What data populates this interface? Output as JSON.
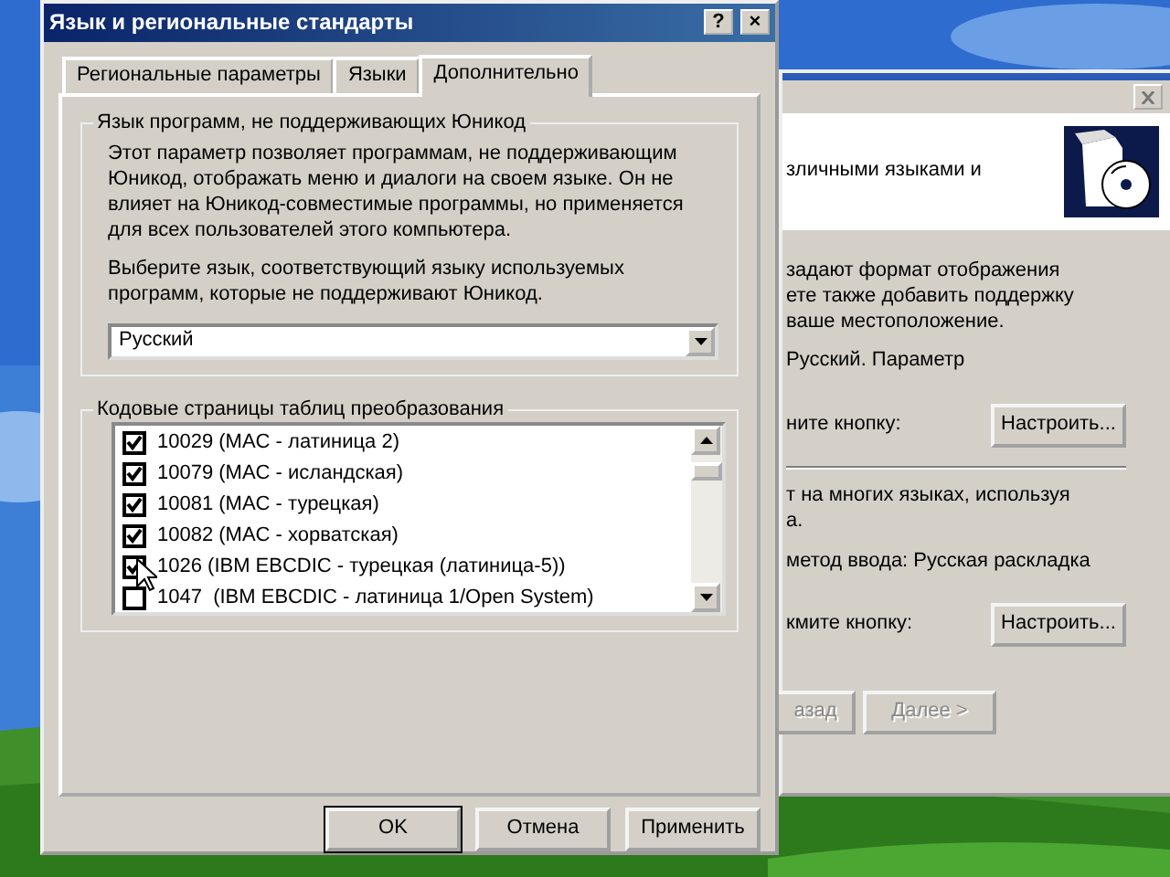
{
  "back_window": {
    "banner_text": "зличными языками и",
    "items": [
      {
        "kind": "text",
        "lines": [
          "задают формат отображения",
          "ете также добавить поддержку",
          "ваше местоположение."
        ]
      },
      {
        "kind": "text",
        "lines": [
          "Русский. Параметр"
        ]
      },
      {
        "kind": "action",
        "text": "ните кнопку:",
        "button": "Настроить..."
      },
      {
        "kind": "divider"
      },
      {
        "kind": "text",
        "lines": [
          "т на многих языках, используя",
          "а."
        ]
      },
      {
        "kind": "text",
        "lines": [
          "метод ввода: Русская раскладка"
        ]
      },
      {
        "kind": "action",
        "text": "кмите кнопку:",
        "button": "Настроить..."
      }
    ],
    "nav_buttons": [
      {
        "label": "азад",
        "disabled": true
      },
      {
        "label": "Далее >",
        "disabled": true
      }
    ]
  },
  "window": {
    "title": "Язык и региональные стандарты",
    "title_buttons": [
      "?",
      "×"
    ]
  },
  "tabs": [
    {
      "label": "Региональные параметры",
      "selected": false
    },
    {
      "label": "Языки",
      "selected": false
    },
    {
      "label": "Дополнительно",
      "selected": true
    }
  ],
  "unicode_group": {
    "label": "Язык программ, не поддерживающих Юникод",
    "paragraphs": [
      "Этот параметр позволяет программам, не поддерживающим Юникод, отображать меню и диалоги на своем языке. Он не влияет на Юникод-совместимые программы, но применяется для всех пользователей этого компьютера.",
      "Выберите язык, соответствующий языку используемых программ, которые не поддерживают Юникод."
    ],
    "select": {
      "value": "Русский"
    }
  },
  "codepages_group": {
    "label": "Кодовые страницы таблиц преобразования",
    "items": [
      {
        "label": "10029 (MAC - латиница 2)",
        "checked": true
      },
      {
        "label": "10079 (MAC - исландская)",
        "checked": true
      },
      {
        "label": "10081 (MAC - турецкая)",
        "checked": true
      },
      {
        "label": "10082 (MAC - хорватская)",
        "checked": true
      },
      {
        "label": "1026 (IBM EBCDIC - турецкая (латиница-5))",
        "checked": true
      },
      {
        "label": "1047  (IBM EBCDIC - латиница 1/Open System)",
        "checked": false
      }
    ]
  },
  "buttons": [
    {
      "label": "OK",
      "default": true
    },
    {
      "label": "Отмена",
      "default": false
    },
    {
      "label": "Применить",
      "default": false
    }
  ]
}
